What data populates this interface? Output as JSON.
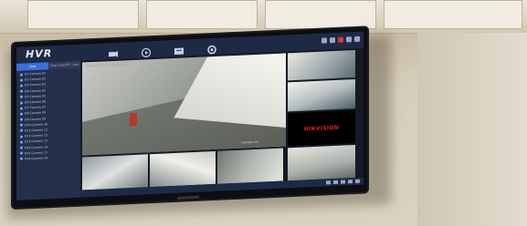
{
  "app": {
    "title": "HVR"
  },
  "sidebar": {
    "tabs": [
      {
        "label": "Live",
        "active": true
      },
      {
        "label": "Channels/IPC Cam",
        "active": false
      }
    ],
    "items": [
      {
        "label": "D1 Camera 01"
      },
      {
        "label": "D2 Camera 02"
      },
      {
        "label": "D3 Camera 03"
      },
      {
        "label": "D4 Camera 04"
      },
      {
        "label": "D5 Camera 05"
      },
      {
        "label": "D6 Camera 06"
      },
      {
        "label": "D7 Camera 07"
      },
      {
        "label": "D8 Camera 08"
      },
      {
        "label": "D9 Camera 09"
      },
      {
        "label": "D10 Camera 10"
      },
      {
        "label": "D11 Camera 11"
      },
      {
        "label": "D12 Camera 12"
      },
      {
        "label": "D13 Camera 13"
      },
      {
        "label": "D14 Camera 14"
      },
      {
        "label": "D15 Camera 15"
      },
      {
        "label": "D16 Camera 16"
      }
    ]
  },
  "main": {
    "big_view_osd": "06-16-2021 Wed 16:28:09",
    "big_view_label": "Camera 01"
  },
  "logo": {
    "text": "HIKVISION"
  },
  "colors": {
    "accent": "#3b6fd8",
    "brand_red": "#d22222"
  }
}
